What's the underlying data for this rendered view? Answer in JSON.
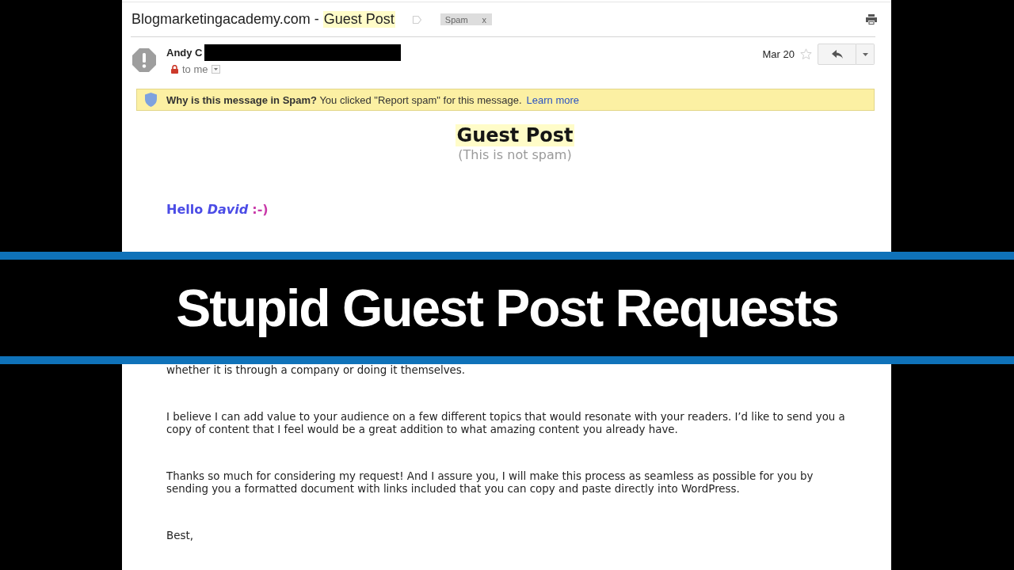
{
  "email": {
    "subject": [
      {
        "text": "Blogmarketingacademy.com -",
        "highlighted": false
      },
      {
        "text": "Guest Post",
        "highlighted": true
      }
    ],
    "labels": [
      {
        "name": "Spam",
        "remove": "x"
      }
    ],
    "sender": {
      "name": "Andy C",
      "redacted": true
    },
    "recipient": "to me",
    "date": "Mar 20",
    "starred": false,
    "spam_notice": {
      "text": "**Why is this message in Spam?** You clicked \"Report spam\" for this message.",
      "link": "Learn more"
    },
    "body": {
      "title": {
        "text": "Guest Post",
        "highlighted": true
      },
      "subtitle": "(This is not spam)",
      "greeting": "Hello *David*",
      "emoticon": ":-)",
      "paragraphs": [
        "whether it is through a company or doing it themselves.",
        "I believe I can add value to your audience on a few different topics that would resonate with your readers. I’d like to send you a copy of content that I feel would be a great addition to what amazing content you already have.",
        "Thanks so much for considering my request! And I assure you, I will make this process as seamless as possible for you by sending you a formatted document with links included that you can copy and paste directly into WordPress.",
        "Best,"
      ]
    }
  },
  "banner": {
    "title": "Stupid Guest Post Requests"
  }
}
